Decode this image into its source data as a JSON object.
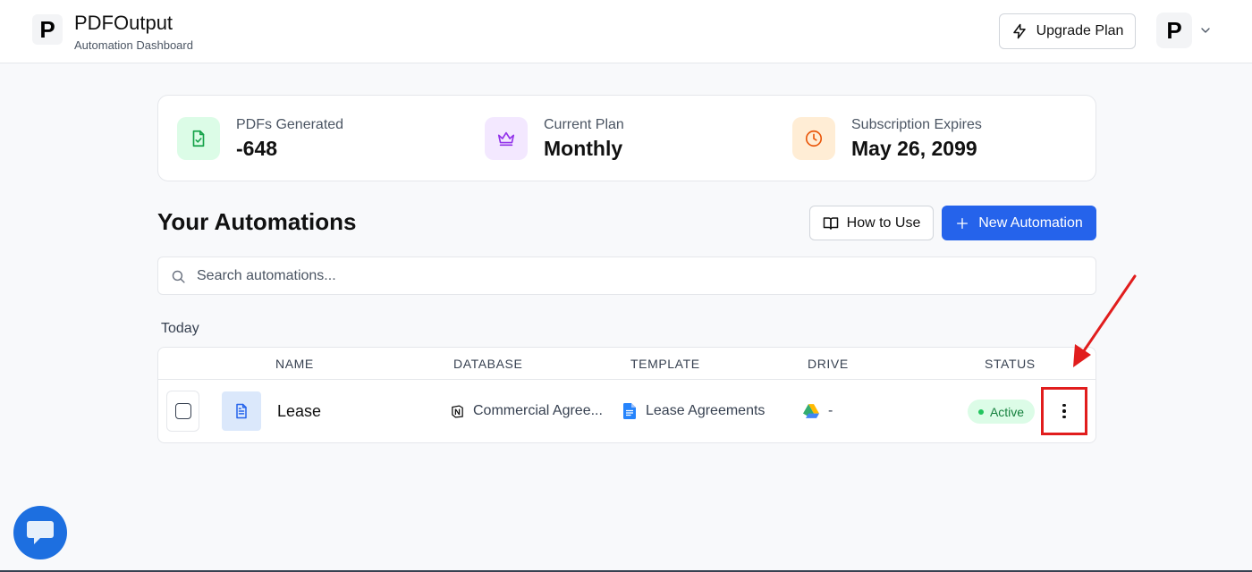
{
  "header": {
    "logo_letter": "P",
    "title": "PDFOutput",
    "subtitle": "Automation Dashboard",
    "upgrade_label": "Upgrade Plan",
    "avatar_letter": "P"
  },
  "stats": [
    {
      "label": "PDFs Generated",
      "value": "-648",
      "icon": "file-check-icon",
      "icon_bg": "#dcfce7",
      "icon_color": "#16a34a"
    },
    {
      "label": "Current Plan",
      "value": "Monthly",
      "icon": "crown-icon",
      "icon_bg": "#f3e8ff",
      "icon_color": "#9333ea"
    },
    {
      "label": "Subscription Expires",
      "value": "May 26, 2099",
      "icon": "clock-icon",
      "icon_bg": "#ffedd5",
      "icon_color": "#ea580c"
    }
  ],
  "automations": {
    "title": "Your Automations",
    "how_to_label": "How to Use",
    "new_label": "New Automation",
    "search_placeholder": "Search automations...",
    "group_label": "Today",
    "columns": [
      "NAME",
      "DATABASE",
      "TEMPLATE",
      "DRIVE",
      "STATUS"
    ],
    "rows": [
      {
        "name": "Lease",
        "database": "Commercial Agree...",
        "template": "Lease Agreements",
        "drive": "-",
        "status": "Active"
      }
    ]
  },
  "colors": {
    "primary": "#2563eb",
    "status_active_bg": "#dcfce7",
    "status_active_text": "#15803d",
    "annotation": "#e11d1d"
  }
}
